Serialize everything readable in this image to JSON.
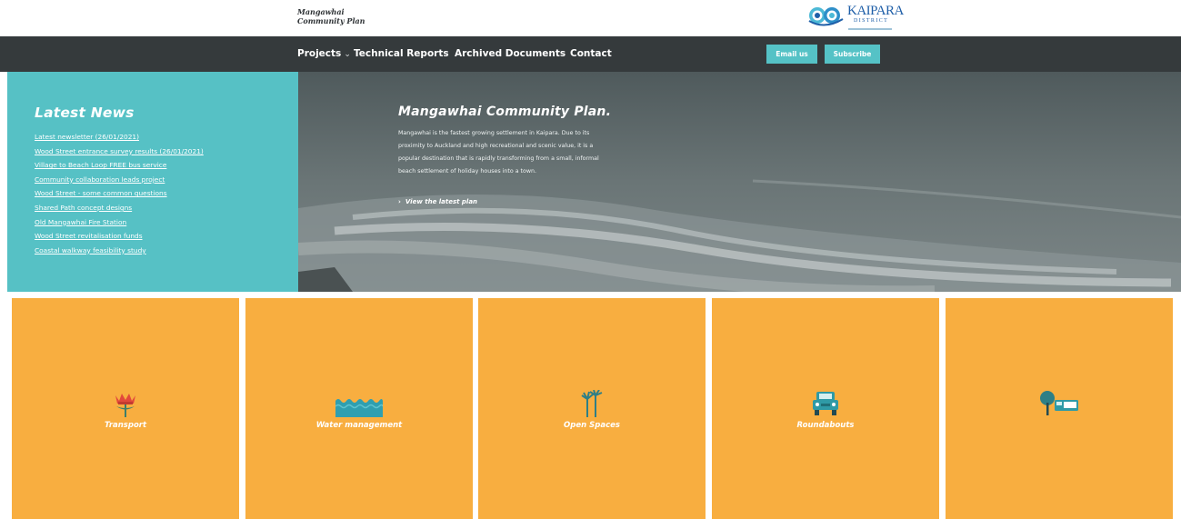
{
  "header": {
    "site_title_line1": "Mangawhai",
    "site_title_line2": "Community Plan",
    "logo_text": "KAIPARA",
    "logo_subtext": "DISTRICT"
  },
  "nav": {
    "items": [
      {
        "label": "Projects",
        "has_dropdown": true
      },
      {
        "label": "Technical Reports"
      },
      {
        "label": "Archived Documents"
      },
      {
        "label": "Contact"
      }
    ],
    "buttons": [
      {
        "label": "Email us"
      },
      {
        "label": "Subscribe"
      }
    ]
  },
  "news": {
    "title": "Latest News",
    "items": [
      "Latest newsletter (26/01/2021)",
      "Wood Street entrance survey results (26/01/2021)",
      "Village to Beach Loop FREE bus service",
      "Community collaboration leads project",
      "Wood Street - some common questions",
      "Shared Path concept designs",
      "Old Mangawhai Fire Station",
      "Wood Street revitalisation funds",
      "Coastal walkway feasibility study"
    ]
  },
  "hero": {
    "title": "Mangawhai Community Plan.",
    "body": "Mangawhai is the fastest growing settlement in Kaipara. Due to its proximity to Auckland and high recreational and scenic value, it is a popular destination that is rapidly transforming from a small, informal beach settlement of holiday houses into a town.",
    "link_arrow": "›",
    "link_label": "View the latest plan"
  },
  "tiles": [
    {
      "label": "Transport",
      "icon": "pohutukawa-flower-icon"
    },
    {
      "label": "Water management",
      "icon": "water-waves-icon"
    },
    {
      "label": "Open Spaces",
      "icon": "nikau-palm-icon"
    },
    {
      "label": "Roundabouts",
      "icon": "car-icon"
    },
    {
      "label": "",
      "icon": "tree-and-bus-icon"
    }
  ],
  "colors": {
    "nav_bg": "#353a3c",
    "teal": "#56c1c5",
    "orange": "#f8ae40",
    "logo_blue": "#1f5fa8"
  }
}
